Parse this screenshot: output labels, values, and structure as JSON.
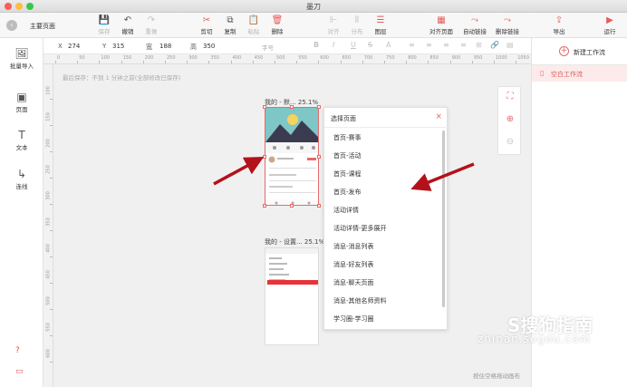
{
  "window": {
    "title": "墨刀"
  },
  "toolbar": {
    "home": "主要页面",
    "buttons": [
      {
        "label": "保存",
        "icon": "💾",
        "enabled": false
      },
      {
        "label": "撤销",
        "icon": "↶",
        "enabled": true
      },
      {
        "label": "重做",
        "icon": "↷",
        "enabled": false
      },
      {
        "label": "剪切",
        "icon": "✂",
        "enabled": true
      },
      {
        "label": "复制",
        "icon": "⧉",
        "enabled": true
      },
      {
        "label": "粘贴",
        "icon": "📋",
        "enabled": false
      },
      {
        "label": "删除",
        "icon": "🗑",
        "enabled": true
      },
      {
        "label": "对齐",
        "icon": "⊩",
        "enabled": false
      },
      {
        "label": "分布",
        "icon": "⦀",
        "enabled": false
      },
      {
        "label": "图层",
        "icon": "☰",
        "enabled": true
      },
      {
        "label": "对齐页面",
        "icon": "▦",
        "enabled": true
      },
      {
        "label": "自动链接",
        "icon": "⤳",
        "enabled": true
      },
      {
        "label": "删除链接",
        "icon": "⤳",
        "enabled": true
      },
      {
        "label": "导出",
        "icon": "⇪",
        "enabled": true
      },
      {
        "label": "运行",
        "icon": "▶",
        "enabled": true
      }
    ]
  },
  "props": {
    "x_label": "X",
    "x": "274",
    "y_label": "Y",
    "y": "315",
    "w_label": "宽",
    "w": "188",
    "h_label": "高",
    "h": "350",
    "font_placeholder": "字号",
    "format_icons": [
      "B",
      "I",
      "U",
      "S",
      "A",
      "≡",
      "≡",
      "≡",
      "≡",
      "⊞",
      "🔗",
      "▤"
    ]
  },
  "left_panel": {
    "items": [
      {
        "label": "批量导入",
        "icon": "🖼"
      },
      {
        "label": "页面",
        "icon": "▣"
      },
      {
        "label": "文本",
        "icon": "T"
      },
      {
        "label": "连线",
        "icon": "↳"
      }
    ],
    "bottom_icons": [
      "?",
      "▭"
    ]
  },
  "rulers": {
    "top": [
      "0",
      "50",
      "100",
      "150",
      "200",
      "250",
      "300",
      "350",
      "400",
      "450",
      "500",
      "550",
      "600",
      "650",
      "700",
      "750",
      "800",
      "850",
      "900",
      "950",
      "1000",
      "1050"
    ],
    "left": [
      "100",
      "150",
      "200",
      "250",
      "300",
      "350",
      "400",
      "450",
      "500",
      "550",
      "600",
      "650"
    ]
  },
  "canvas": {
    "autosave": "最后保存：不到 1 分钟之前(全部修改已保存)",
    "page1_title": "我的 - 默... 25.1%",
    "page2_title": "我的 - 设置... 25.1%",
    "hint": "按住空格拖动画布"
  },
  "dropdown": {
    "title": "选择页面",
    "close": "×",
    "items": [
      "首页-赛事",
      "首页-活动",
      "首页-课程",
      "首页-发布",
      "活动详情",
      "活动详情-更多展开",
      "消息-消息列表",
      "消息-好友列表",
      "消息-聊天页面",
      "消息-其他名师资料",
      "学习圈-学习圈"
    ]
  },
  "right_panel": {
    "new_flow": "新建工作流",
    "flow": "空白工作流"
  },
  "watermark": {
    "text": "S搜狗指南",
    "url": "zhinan.sogou.com"
  },
  "colors": {
    "accent": "#e46a6a",
    "arrow": "#b3121b"
  }
}
